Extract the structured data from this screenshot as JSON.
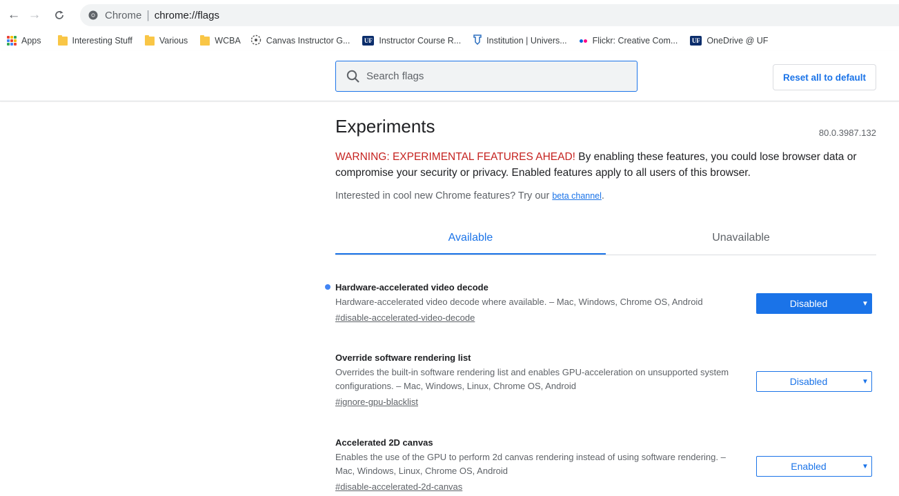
{
  "browser": {
    "chip_label": "Chrome",
    "separator": "|",
    "url": "chrome://flags",
    "bookmarks": [
      {
        "label": "Apps",
        "icon": "apps-grid-icon"
      },
      {
        "label": "Interesting Stuff",
        "icon": "folder-icon"
      },
      {
        "label": "Various",
        "icon": "folder-icon"
      },
      {
        "label": "WCBA",
        "icon": "folder-icon"
      },
      {
        "label": "Canvas Instructor G...",
        "icon": "canvas-logo-icon"
      },
      {
        "label": "Instructor Course R...",
        "icon": "uf-logo-icon"
      },
      {
        "label": "Institution | Univers...",
        "icon": "institution-icon"
      },
      {
        "label": "Flickr: Creative Com...",
        "icon": "flickr-icon"
      },
      {
        "label": "OneDrive @ UF",
        "icon": "uf-logo-icon"
      }
    ]
  },
  "flags": {
    "search_placeholder": "Search flags",
    "reset_label": "Reset all to default",
    "title": "Experiments",
    "version": "80.0.3987.132",
    "warning_strong": "WARNING: EXPERIMENTAL FEATURES AHEAD!",
    "warning_rest": " By enabling these features, you could lose browser data or compromise your security or privacy. Enabled features apply to all users of this browser.",
    "interest_text": "Interested in cool new Chrome features? Try our ",
    "beta_link": "beta channel",
    "interest_end": ".",
    "tabs": [
      {
        "label": "Available",
        "selected": true
      },
      {
        "label": "Unavailable",
        "selected": false
      }
    ],
    "experiments": [
      {
        "name": "Hardware-accelerated video decode",
        "description": "Hardware-accelerated video decode where available. – Mac, Windows, Chrome OS, Android",
        "permalink": "#disable-accelerated-video-decode",
        "value": "Disabled",
        "modified": true
      },
      {
        "name": "Override software rendering list",
        "description": "Overrides the built-in software rendering list and enables GPU-acceleration on unsupported system configurations. – Mac, Windows, Linux, Chrome OS, Android",
        "permalink": "#ignore-gpu-blacklist",
        "value": "Disabled",
        "modified": false
      },
      {
        "name": "Accelerated 2D canvas",
        "description": "Enables the use of the GPU to perform 2d canvas rendering instead of using software rendering. – Mac, Windows, Linux, Chrome OS, Android",
        "permalink": "#disable-accelerated-2d-canvas",
        "value": "Enabled",
        "modified": false
      }
    ]
  },
  "colors": {
    "accent": "#1a73e8",
    "warning": "#c5221f",
    "modified_dot": "#4285f4"
  }
}
